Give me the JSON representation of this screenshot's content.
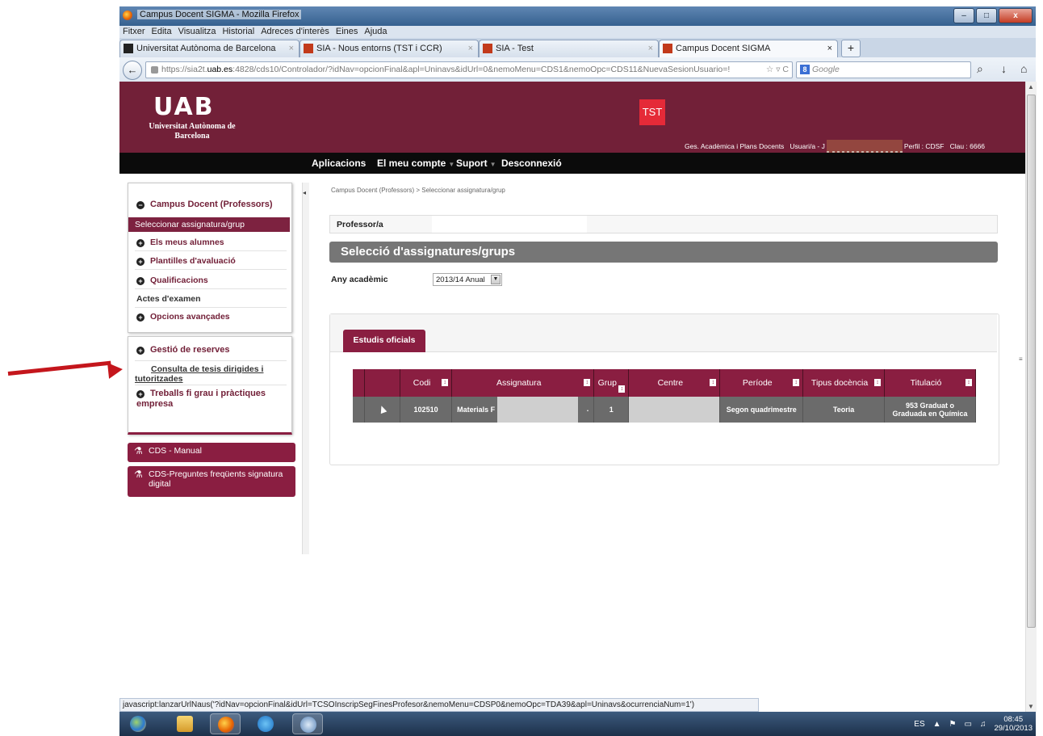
{
  "window": {
    "title": "Campus Docent SIGMA - Mozilla Firefox",
    "min": "–",
    "max": "□",
    "close": "x"
  },
  "menubar": [
    "Fitxer",
    "Edita",
    "Visualitza",
    "Historial",
    "Adreces d'interès",
    "Eines",
    "Ajuda"
  ],
  "tabs": [
    {
      "label": "Universitat Autònoma de Barcelona",
      "close": "×"
    },
    {
      "label": "SIA - Nous entorns (TST i CCR)",
      "close": "×"
    },
    {
      "label": "SIA - Test",
      "close": "×"
    },
    {
      "label": "Campus Docent SIGMA",
      "close": "×"
    }
  ],
  "newtab": "+",
  "nav": {
    "back": "←",
    "url_prefix": "https://sia2t.",
    "url_host": "uab.es",
    "url_rest": ":4828/cds10/Controlador/?idNav=opcionFinal&apl=Uninavs&idUrl=0&nemoMenu=CDS1&nemoOpc=CDS11&NuevaSesionUsuario=!",
    "url_ctrls": "☆ ▿ C",
    "search_engine": "8",
    "search_placeholder": "Google",
    "search_icon": "⌕",
    "download_icon": "↓",
    "home_icon": "⌂"
  },
  "header": {
    "logo": "UAB",
    "logo_sub": "Universitat Autònoma de Barcelona",
    "env": "TST",
    "area": "Ges. Acadèmica i Plans Docents",
    "user_label": "Usuari/a - J",
    "profile": "Perfil : CDSF",
    "key": "Clau : 6666"
  },
  "topmenu": [
    {
      "label": "Aplicacions"
    },
    {
      "label": "El meu compte",
      "arrow": "▼"
    },
    {
      "label": "Suport",
      "arrow": "▼"
    },
    {
      "label": "Desconnexió"
    }
  ],
  "sidebar": {
    "group": "Campus Docent (Professors)",
    "group_icon": "−",
    "selected": "Seleccionar assignatura/grup",
    "items": [
      {
        "label": "Els meus alumnes",
        "icon": "+"
      },
      {
        "label": "Plantilles d'avaluació",
        "icon": "+"
      },
      {
        "label": "Qualificacions",
        "icon": "+"
      },
      {
        "label": "Actes d'examen"
      },
      {
        "label": "Opcions avançades",
        "icon": "+"
      }
    ],
    "group2": "Gestió de reserves",
    "group2_icon": "+",
    "link_tesis": "Consulta de tesis dirigides i tutoritzades",
    "group3": "Treballs fi grau i pràctiques empresa",
    "group3_icon": "+",
    "buttons": [
      {
        "label": "CDS - Manual",
        "icon": "⚗"
      },
      {
        "label": "CDS-Preguntes freqüents signatura digital",
        "icon": "⚗"
      }
    ],
    "collapse": "◂",
    "splitter": "≡"
  },
  "main": {
    "breadcrumb": "Campus Docent (Professors) > Seleccionar assignatura/grup",
    "professor_label": "Professor/a",
    "section_title": "Selecció d'assignatures/grups",
    "year_label": "Any acadèmic",
    "year_value": "2013/14 Anual",
    "year_dd": "▼",
    "tab_label": "Estudis oficials",
    "sort_icon": "↕",
    "columns": [
      "",
      "",
      "Codi",
      "Assignatura",
      "Grup",
      "Centre",
      "Període",
      "Tipus docència",
      "Titulació"
    ],
    "row": {
      "codi": "102510",
      "assignatura": "Materials F",
      "assignatura_tail": ".",
      "grup": "1",
      "centre": "",
      "periode": "Segon quadrimestre",
      "tipus": "Teoria",
      "titulacio": "953  Graduat o Graduada en Química"
    }
  },
  "scrollbar": {
    "up": "▲",
    "down": "▼"
  },
  "statusbar": "javascript:lanzarUrlNaus('?idNav=opcionFinal&idUrl=TCSOInscripSegFinesProfesor&nemoMenu=CDSP0&nemoOpc=TDA39&apl=Uninavs&ocurrenciaNum=1')",
  "taskbar": {
    "lang": "ES",
    "tray_up": "▲",
    "flag": "⚑",
    "network": "▭",
    "volume": "♫",
    "time": "08:45",
    "date": "29/10/2013"
  },
  "colors": {
    "brand": "#722038",
    "accent": "#8a1e41",
    "tst": "#e52a38",
    "arrow": "#c4161c"
  }
}
